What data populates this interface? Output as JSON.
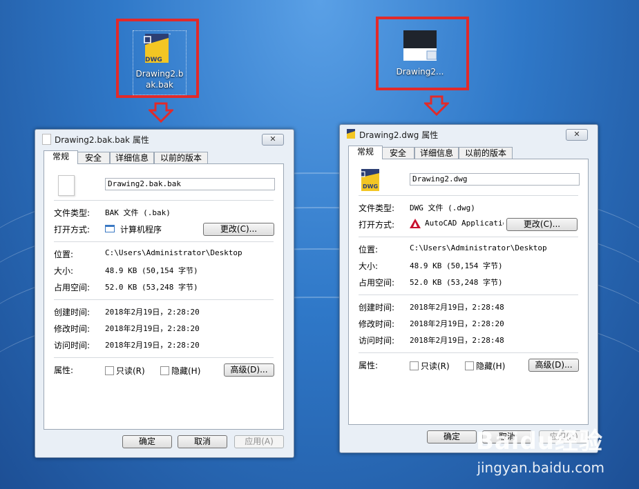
{
  "desktop": {
    "bak_icon_label": "Drawing2.b\nak.bak",
    "dwg_icon_label": "Drawing2...",
    "dwg_badge": "DWG"
  },
  "bak_dialog": {
    "title": "Drawing2.bak.bak 属性",
    "close": "✕",
    "tabs": [
      "常规",
      "安全",
      "详细信息",
      "以前的版本"
    ],
    "filename": "Drawing2.bak.bak",
    "file_type_label": "文件类型:",
    "file_type_value": "BAK 文件 (.bak)",
    "open_with_label": "打开方式:",
    "open_with_value": "计算机程序",
    "change_button": "更改(C)...",
    "location_label": "位置:",
    "location_value": "C:\\Users\\Administrator\\Desktop",
    "size_label": "大小:",
    "size_value": "48.9 KB (50,154 字节)",
    "disk_size_label": "占用空间:",
    "disk_size_value": "52.0 KB (53,248 字节)",
    "created_label": "创建时间:",
    "created_value": "2018年2月19日，2:28:20",
    "modified_label": "修改时间:",
    "modified_value": "2018年2月19日，2:28:20",
    "accessed_label": "访问时间:",
    "accessed_value": "2018年2月19日，2:28:20",
    "attributes_label": "属性:",
    "readonly_label": "只读(R)",
    "hidden_label": "隐藏(H)",
    "advanced_button": "高级(D)...",
    "ok_button": "确定",
    "cancel_button": "取消",
    "apply_button": "应用(A)"
  },
  "dwg_dialog": {
    "title": "Drawing2.dwg 属性",
    "close": "✕",
    "tabs": [
      "常规",
      "安全",
      "详细信息",
      "以前的版本"
    ],
    "filename": "Drawing2.dwg",
    "file_type_label": "文件类型:",
    "file_type_value": "DWG 文件 (.dwg)",
    "open_with_label": "打开方式:",
    "open_with_value": "AutoCAD Applicatior",
    "change_button": "更改(C)...",
    "location_label": "位置:",
    "location_value": "C:\\Users\\Administrator\\Desktop",
    "size_label": "大小:",
    "size_value": "48.9 KB (50,154 字节)",
    "disk_size_label": "占用空间:",
    "disk_size_value": "52.0 KB (53,248 字节)",
    "created_label": "创建时间:",
    "created_value": "2018年2月19日，2:28:48",
    "modified_label": "修改时间:",
    "modified_value": "2018年2月19日，2:28:20",
    "accessed_label": "访问时间:",
    "accessed_value": "2018年2月19日，2:28:48",
    "attributes_label": "属性:",
    "readonly_label": "只读(R)",
    "hidden_label": "隐藏(H)",
    "advanced_button": "高级(D)...",
    "ok_button": "确定",
    "cancel_button": "取消",
    "apply_button": "应用(A)"
  },
  "watermark": {
    "brand": "Baidu经验",
    "url": "jingyan.baidu.com"
  },
  "colors": {
    "highlight_red": "#e12a2a",
    "desktop_blue": "#2f78c8"
  }
}
